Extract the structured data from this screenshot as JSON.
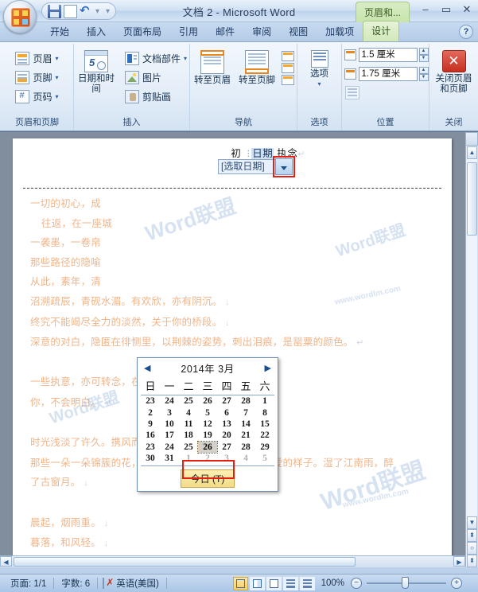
{
  "window": {
    "title": "文档 2 - Microsoft Word",
    "contextual_tab": "页眉和...",
    "minimize": "–",
    "maximize": "▭",
    "close": "✕",
    "help": "?"
  },
  "quick_access": {
    "save": "save-icon",
    "new": "new-icon",
    "undo": "undo-icon",
    "more": "▾"
  },
  "tabs": [
    {
      "label": "开始",
      "active": false
    },
    {
      "label": "插入",
      "active": false
    },
    {
      "label": "页面布局",
      "active": false
    },
    {
      "label": "引用",
      "active": false
    },
    {
      "label": "邮件",
      "active": false
    },
    {
      "label": "审阅",
      "active": false
    },
    {
      "label": "视图",
      "active": false
    },
    {
      "label": "加载项",
      "active": false
    },
    {
      "label": "设计",
      "active": true
    }
  ],
  "ribbon": {
    "groups": [
      {
        "name": "页眉和页脚",
        "items": [
          {
            "label": "页眉",
            "dropdown": "▾"
          },
          {
            "label": "页脚",
            "dropdown": "▾"
          },
          {
            "label": "页码",
            "dropdown": "▾"
          }
        ]
      },
      {
        "name": "插入",
        "date_button": "日期和时间",
        "items": [
          {
            "label": "文档部件",
            "dropdown": "▾"
          },
          {
            "label": "图片",
            "dropdown": ""
          },
          {
            "label": "剪贴画",
            "dropdown": ""
          }
        ]
      },
      {
        "name": "导航",
        "goto_header": "转至页眉",
        "goto_footer": "转至页脚"
      },
      {
        "name": "选项",
        "options_label": "选项",
        "options_arrow": "▾"
      },
      {
        "name": "位置",
        "header_from_top": "1.5 厘米",
        "footer_from_bottom": "1.75 厘米",
        "spin_up": "▲",
        "spin_down": "▼"
      },
      {
        "name": "关闭",
        "close_label": "关闭页眉和页脚",
        "close_icon": "✕"
      }
    ]
  },
  "document": {
    "header_text_prefix": "初",
    "header_content_control": "日期",
    "header_text_suffix": "执念",
    "header_pilcrow": "↵",
    "date_picker_placeholder": "[选取日期]",
    "date_picker_dropdown": "▾",
    "paragraphs": [
      "一切的初心，成",
      "往返，在一座城",
      "一袭墨，一卷帛",
      "那些路径的隐喻",
      "从此，素年，清",
      "沼溯疏辰，青砚水湄。有欢欣，亦有阴沉。",
      "终究不能竭尽全力的淡然，关于你的桥段。",
      "深意的对白，隐匿在徘恻里，以荆棘的姿势，刺出泪痕，是罂粟的颜色。",
      "一些执意，亦可转念，在至信殆尽的瞬间。",
      "你，不会明白。",
      "时光浅淡了许久。携风而来的，是你的声音，很旷远。",
      "那些一朵一朵锦簇的花，是写在墨迹里的爱恋，开成疼爱的样子。湿了江南雨，醉",
      "了古窗月。",
      "晨起，烟雨重。",
      "暮落，和风轻。"
    ],
    "marks": {
      "soft_return": "↓",
      "paragraph": "↵"
    }
  },
  "calendar": {
    "prev_arrow": "◀",
    "next_arrow": "▶",
    "month_title": "2014年 3月",
    "weekdays": [
      "日",
      "一",
      "二",
      "三",
      "四",
      "五",
      "六"
    ],
    "weeks": [
      [
        {
          "d": "23",
          "o": true
        },
        {
          "d": "24",
          "o": true
        },
        {
          "d": "25",
          "o": true
        },
        {
          "d": "26",
          "o": true
        },
        {
          "d": "27",
          "o": true
        },
        {
          "d": "28",
          "o": true
        },
        {
          "d": "1",
          "o": false
        }
      ],
      [
        {
          "d": "2",
          "o": false
        },
        {
          "d": "3",
          "o": false
        },
        {
          "d": "4",
          "o": false
        },
        {
          "d": "5",
          "o": false
        },
        {
          "d": "6",
          "o": false
        },
        {
          "d": "7",
          "o": false
        },
        {
          "d": "8",
          "o": false
        }
      ],
      [
        {
          "d": "9",
          "o": false
        },
        {
          "d": "10",
          "o": false
        },
        {
          "d": "11",
          "o": false
        },
        {
          "d": "12",
          "o": false
        },
        {
          "d": "13",
          "o": false
        },
        {
          "d": "14",
          "o": false
        },
        {
          "d": "15",
          "o": false
        }
      ],
      [
        {
          "d": "16",
          "o": false
        },
        {
          "d": "17",
          "o": false
        },
        {
          "d": "18",
          "o": false
        },
        {
          "d": "19",
          "o": false
        },
        {
          "d": "20",
          "o": false
        },
        {
          "d": "21",
          "o": false
        },
        {
          "d": "22",
          "o": false
        }
      ],
      [
        {
          "d": "23",
          "o": false
        },
        {
          "d": "24",
          "o": false
        },
        {
          "d": "25",
          "o": false
        },
        {
          "d": "26",
          "o": false,
          "sel": true
        },
        {
          "d": "27",
          "o": false
        },
        {
          "d": "28",
          "o": false
        },
        {
          "d": "29",
          "o": false
        }
      ],
      [
        {
          "d": "30",
          "o": false
        },
        {
          "d": "31",
          "o": false
        },
        {
          "d": "1",
          "o": true
        },
        {
          "d": "2",
          "o": true
        },
        {
          "d": "3",
          "o": true
        },
        {
          "d": "4",
          "o": true
        },
        {
          "d": "5",
          "o": true
        }
      ]
    ],
    "today_button": "今日 (T)",
    "selected_day": "26"
  },
  "status": {
    "page": "页面: 1/1",
    "words": "字数: 6",
    "spell_icon": "spellcheck-icon",
    "language": "英语(美国)",
    "views": [
      "print-layout-view",
      "full-screen-reading-view",
      "web-layout-view",
      "outline-view",
      "draft-view"
    ],
    "active_view": "print-layout-view",
    "zoom": "100%",
    "zoom_out": "−",
    "zoom_in": "+"
  },
  "watermarks": {
    "brand": "Word联盟",
    "url": "www.wordlm.com"
  },
  "colors": {
    "accent_green": "#d3e9bc",
    "highlight_red": "#e51f12",
    "body_text": "#f0b58a",
    "chrome_blue": "#bcd2ea"
  }
}
